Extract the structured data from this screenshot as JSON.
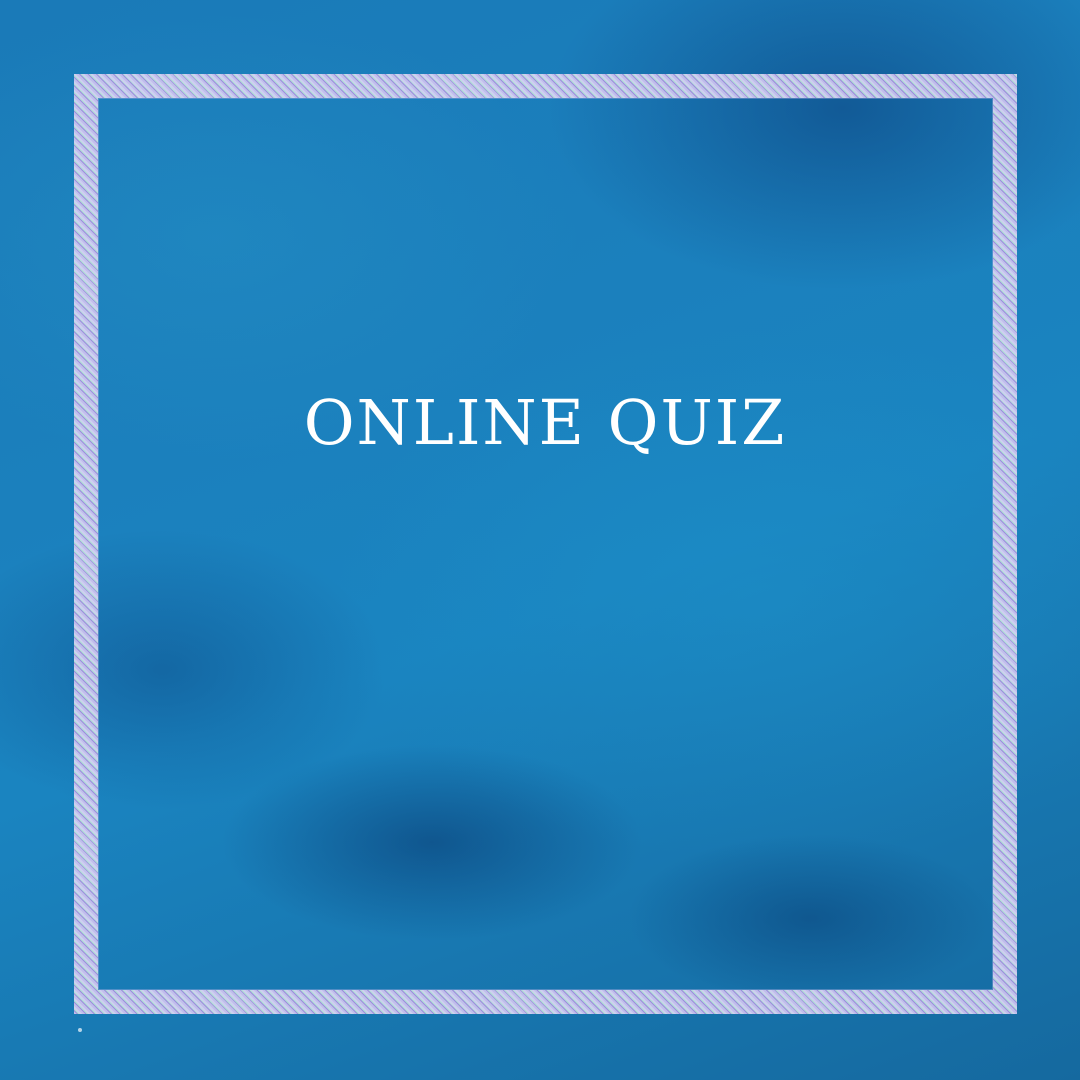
{
  "title": "ONLINE QUIZ",
  "colors": {
    "background": "#1a7ab8",
    "frame": "#c9c3ee",
    "frame_accent_purple": "#a58fe0",
    "frame_accent_green": "#b8e8d6",
    "title_text": "#ffffff"
  }
}
